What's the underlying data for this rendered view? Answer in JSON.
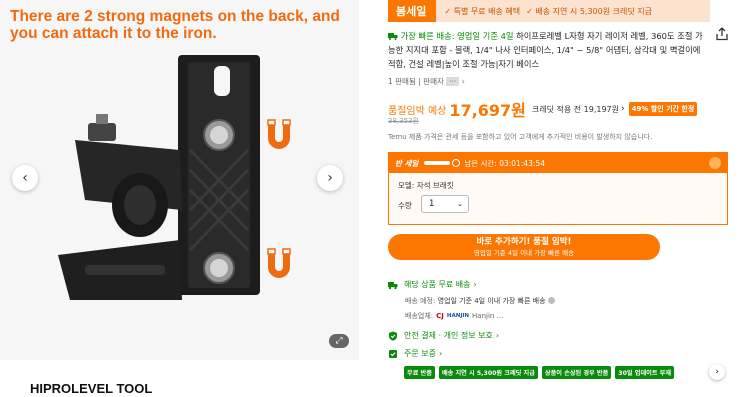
{
  "gallery": {
    "overlay_text": "There are 2 strong magnets on the back, and you can attach it to the iron.",
    "prev_arrow": "‹",
    "next_arrow": "›",
    "brand_title": "HIPROLEVEL TOOL"
  },
  "banner": {
    "sale_label": "봄세일",
    "perks": [
      "✓ 특별 무료 배송 혜택",
      "✓ 배송 지연 시 5,300원 크레딧 지급"
    ]
  },
  "product": {
    "fast_delivery": "가장 빠른 배송: 영업일 기준 4일",
    "title": "하이프로레벨 L자형 자기 레이저 레벨, 360도 조절 가능한 지지대 포함 - 블랙, 1/4\" 나사 인터페이스, 1/4\" ~ 5/8\" 어댑터, 삼각대 및 벽걸이에 적합, 건설 레벨|높이 조절 가능|자기 베이스",
    "sold_count": "1 판매됨",
    "seller_label": "판매자",
    "seller_name": "···"
  },
  "price": {
    "label": "품절임박 예상",
    "value": "17,697원",
    "credit_text": "크레딧 적용 전 19,197원",
    "discount_badge": "49% 할인 기간 한정",
    "old_price": "38,353원",
    "notice": "Temu 제품 가격은 관세 등을 포함하고 있어 고객에게 추가적인 비용이 발생하지 않습니다."
  },
  "flash": {
    "label": "반 세일",
    "remaining": "남은 시간: 03:01:43:54",
    "model": "모델: 자석 브래킷",
    "qty_label": "수량",
    "qty_value": "1"
  },
  "buy_button": {
    "main": "바로 추가하기! 품절 임박!",
    "sub": "영업일 기준 4일 이내 가장 빠른 배송"
  },
  "shipping": {
    "title": "해당 상품 무료 배송",
    "eta_label": "배송 예정:",
    "eta_value": "영업일 기준 4일 이내 가장 빠른 배송",
    "carrier_label": "배송업체:",
    "carrier_cj": "CJ",
    "carrier_hanjin_logo": "HANJIN",
    "carrier_hanjin": "Hanjin ..."
  },
  "safety": {
    "title": "안전 결제 · 개인 정보 보호"
  },
  "protection": {
    "title": "주문 보증",
    "badges": [
      "무료 반품",
      "배송 지연 시 5,300원 크레딧 지급",
      "상품이 손상된 경우 반품",
      "30일 업데이트 부재"
    ]
  },
  "colors": {
    "accent": "#fb7701",
    "green": "#0a8a0a"
  }
}
